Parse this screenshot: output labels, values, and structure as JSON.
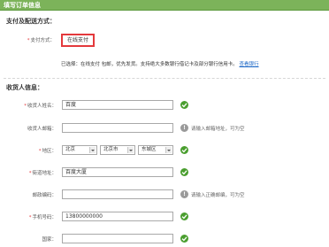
{
  "header": {
    "title": "填写订单信息"
  },
  "payment": {
    "section_title": "支付及配送方式：",
    "field_label": "支付方式：",
    "selected_option": "在线支付",
    "info_prefix": "已选择：",
    "info_text": "在线支付 包邮，优先发货。支持绝大多数银行借记卡及部分银行信用卡。",
    "info_link": "查看银行"
  },
  "recipient": {
    "section_title": "收货人信息：",
    "name": {
      "label": "收货人姓名：",
      "value": "百度"
    },
    "email": {
      "label": "收货人邮箱：",
      "value": "",
      "hint": "请输入邮箱地址，可为空"
    },
    "region": {
      "label": "地区：",
      "province": "北京",
      "city": "北京市",
      "district": "东城区"
    },
    "address": {
      "label": "街道地址：",
      "value": "百度大厦"
    },
    "postcode": {
      "label": "邮政编码：",
      "value": "",
      "hint": "请输入正确邮编，可为空"
    },
    "mobile": {
      "label": "手机号码：",
      "value": "13800000000"
    },
    "country": {
      "label": "国家：",
      "value": ""
    }
  },
  "colors": {
    "header_bg": "#7cb35a",
    "accent_red": "#e4393c",
    "ok_green": "#4a9e2f",
    "link_blue": "#1a66c6"
  }
}
